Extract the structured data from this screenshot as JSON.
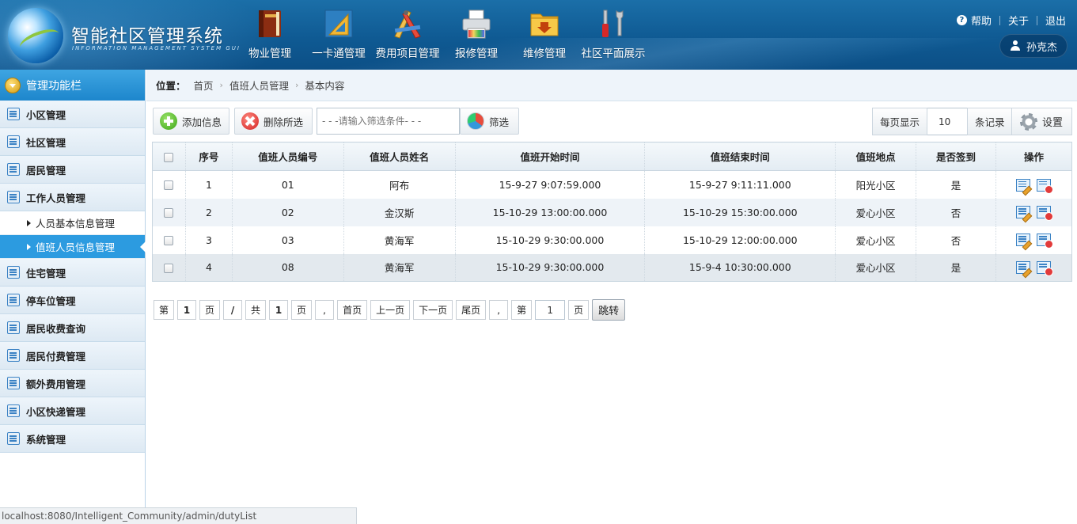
{
  "header": {
    "logo_title": "智能社区管理系统",
    "logo_subtitle": "INFORMATION MANAGEMENT SYSTEM GUI",
    "nav": [
      {
        "label": "物业管理",
        "icon": "book-icon"
      },
      {
        "label": "一卡通管理",
        "icon": "ruler-triangle-icon"
      },
      {
        "label": "费用项目管理",
        "icon": "drafting-tools-icon"
      },
      {
        "label": "报修管理",
        "icon": "printer-icon"
      },
      {
        "label": "维修管理",
        "icon": "download-folder-icon"
      },
      {
        "label": "社区平面展示",
        "icon": "tools-icon"
      }
    ],
    "help": "帮助",
    "about": "关于",
    "logout": "退出",
    "username": "孙克杰"
  },
  "sidebar": {
    "title": "管理功能栏",
    "items": [
      {
        "label": "小区管理"
      },
      {
        "label": "社区管理"
      },
      {
        "label": "居民管理"
      },
      {
        "label": "工作人员管理"
      }
    ],
    "subitems": [
      {
        "label": "人员基本信息管理"
      },
      {
        "label": "值班人员信息管理"
      }
    ],
    "items_after": [
      {
        "label": "住宅管理"
      },
      {
        "label": "停车位管理"
      },
      {
        "label": "居民收费查询"
      },
      {
        "label": "居民付费管理"
      },
      {
        "label": "额外费用管理"
      },
      {
        "label": "小区快递管理"
      },
      {
        "label": "系统管理"
      }
    ]
  },
  "breadcrumb": {
    "position_label": "位置：",
    "items": [
      "首页",
      "值班人员管理",
      "基本内容"
    ]
  },
  "toolbar": {
    "add_label": "添加信息",
    "delete_label": "删除所选",
    "filter_placeholder": "- - -请输入筛选条件- - -",
    "filter_label": "筛选",
    "per_page_label": "每页显示",
    "per_page_value": "10",
    "records_label": "条记录",
    "settings_label": "设置"
  },
  "table": {
    "columns": [
      "序号",
      "值班人员编号",
      "值班人员姓名",
      "值班开始时间",
      "值班结束时间",
      "值班地点",
      "是否签到",
      "操作"
    ],
    "rows": [
      {
        "no": "1",
        "code": "01",
        "name": "阿布",
        "start": "15-9-27 9:07:59.000",
        "end": "15-9-27 9:11:11.000",
        "place": "阳光小区",
        "signed": "是"
      },
      {
        "no": "2",
        "code": "02",
        "name": "金汉斯",
        "start": "15-10-29 13:00:00.000",
        "end": "15-10-29 15:30:00.000",
        "place": "爱心小区",
        "signed": "否"
      },
      {
        "no": "3",
        "code": "03",
        "name": "黄海军",
        "start": "15-10-29 9:30:00.000",
        "end": "15-10-29 12:00:00.000",
        "place": "爱心小区",
        "signed": "否"
      },
      {
        "no": "4",
        "code": "08",
        "name": "黄海军",
        "start": "15-10-29 9:30:00.000",
        "end": "15-9-4 10:30:00.000",
        "place": "爱心小区",
        "signed": "是"
      }
    ]
  },
  "pager": {
    "di": "第",
    "current": "1",
    "ye": "页",
    "slash": "/",
    "gong": "共",
    "total": "1",
    "ye2": "页",
    "comma": ",",
    "first": "首页",
    "prev": "上一页",
    "next": "下一页",
    "last": "尾页",
    "comma2": ",",
    "di2": "第",
    "jump_value": "1",
    "ye3": "页",
    "go": "跳转"
  },
  "statusbar": {
    "url": "localhost:8080/Intelligent_Community/admin/dutyList"
  }
}
